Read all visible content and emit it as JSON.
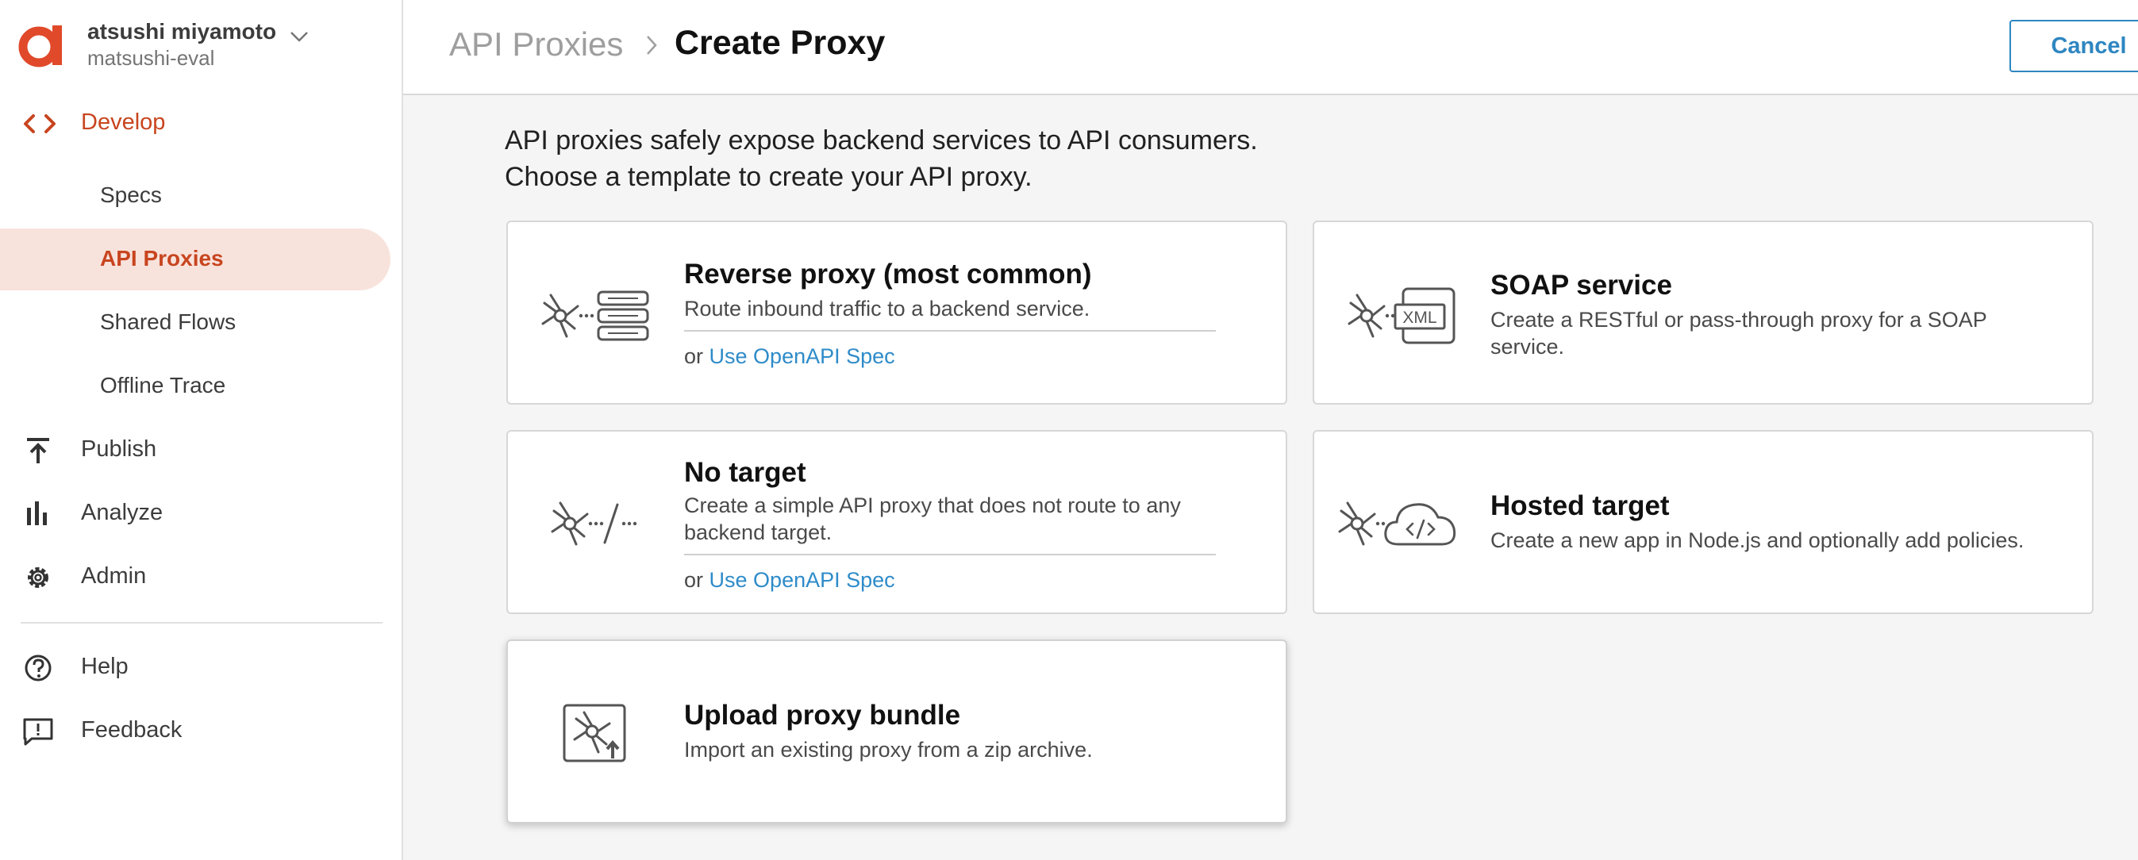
{
  "account": {
    "name": "atsushi miyamoto",
    "org": "matsushi-eval",
    "logo_letter": "a",
    "brand_color": "#e0492a"
  },
  "nav": {
    "develop": "Develop",
    "sub": [
      "Specs",
      "API Proxies",
      "Shared Flows",
      "Offline Trace"
    ],
    "active_sub": "API Proxies",
    "publish": "Publish",
    "analyze": "Analyze",
    "admin": "Admin",
    "help": "Help",
    "feedback": "Feedback"
  },
  "header": {
    "breadcrumb_parent": "API Proxies",
    "title": "Create Proxy",
    "cancel": "Cancel"
  },
  "intro": {
    "line1": "API proxies safely expose backend services to API consumers.",
    "line2": "Choose a template to create your API proxy."
  },
  "cards": {
    "reverse": {
      "title": "Reverse proxy (most common)",
      "desc": "Route inbound traffic to a backend service.",
      "or": "or",
      "link": "Use OpenAPI Spec"
    },
    "soap": {
      "title": "SOAP service",
      "desc": "Create a RESTful or pass-through proxy for a SOAP service.",
      "icon_text": "XML"
    },
    "notarget": {
      "title": "No target",
      "desc": "Create a simple API proxy that does not route to any backend target.",
      "or": "or",
      "link": "Use OpenAPI Spec"
    },
    "hosted": {
      "title": "Hosted target",
      "desc": "Create a new app in Node.js and optionally add policies."
    },
    "upload": {
      "title": "Upload proxy bundle",
      "desc": "Import an existing proxy from a zip archive."
    }
  },
  "colors": {
    "accent": "#c8451f",
    "active_bg": "#f8e3dc",
    "link": "#2e8bc9"
  }
}
